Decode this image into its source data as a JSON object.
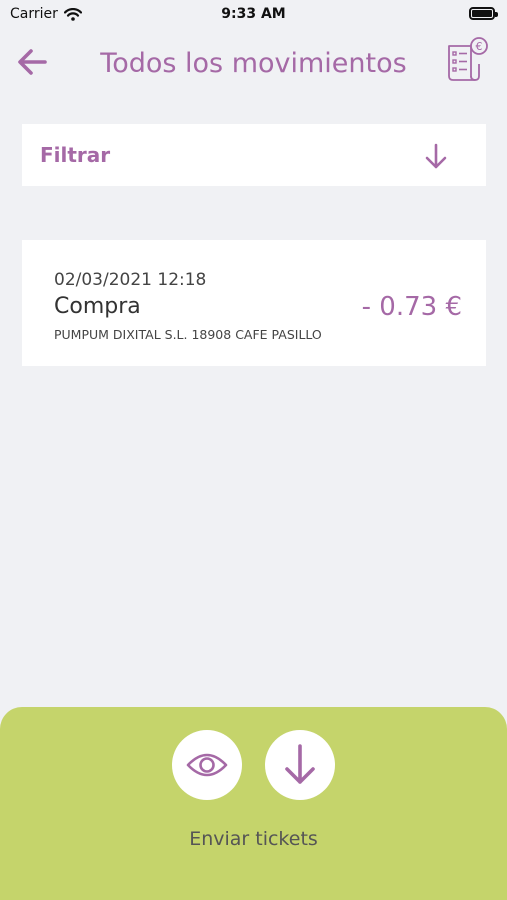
{
  "status_bar": {
    "carrier": "Carrier",
    "time": "9:33 AM",
    "icons": [
      "wifi-icon",
      "battery-icon"
    ]
  },
  "header": {
    "title": "Todos los movimientos",
    "back_icon": "arrow-left-icon",
    "receipt_icon": "receipt-euro-icon"
  },
  "filter": {
    "label": "Filtrar",
    "icon": "arrow-down-icon"
  },
  "transactions": [
    {
      "datetime": "02/03/2021 12:18",
      "type": "Compra",
      "merchant": "PUMPUM DIXITAL S.L. 18908 CAFE PASILLO",
      "amount": "- 0.73 €"
    }
  ],
  "bottom_panel": {
    "send_label": "Enviar tickets",
    "actions": [
      "eye-icon",
      "download-arrow-icon"
    ]
  },
  "colors": {
    "accent": "#a569a6",
    "background": "#f0f1f4",
    "panel": "#c5d46b",
    "card": "#ffffff"
  }
}
